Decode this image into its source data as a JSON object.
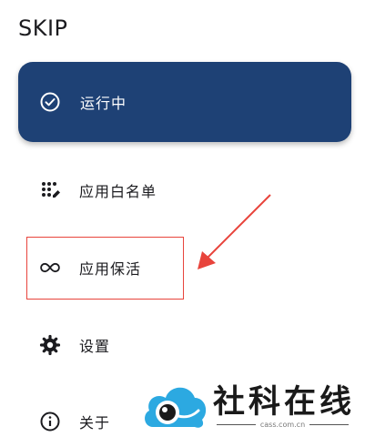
{
  "app": {
    "title": "SKIP"
  },
  "status": {
    "label": "运行中",
    "icon": "check-circle-icon"
  },
  "menu": [
    {
      "label": "应用白名单",
      "icon": "dots-grid-icon"
    },
    {
      "label": "应用保活",
      "icon": "infinity-icon"
    },
    {
      "label": "设置",
      "icon": "gear-icon"
    },
    {
      "label": "关于",
      "icon": "info-icon"
    }
  ],
  "watermark": {
    "text": "社科在线",
    "domain": "cass.com.cn"
  },
  "colors": {
    "status_card": "#1e4175",
    "annotation": "#e8443c",
    "watermark_blue": "#2ca9e1"
  }
}
